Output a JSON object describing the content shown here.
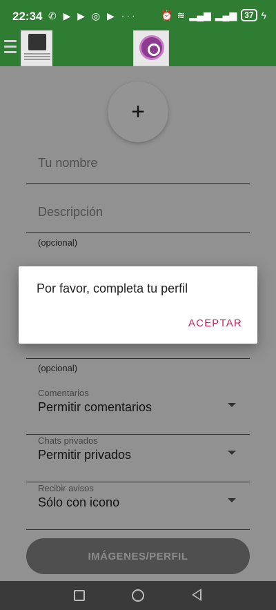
{
  "status_bar": {
    "time": "22:34",
    "left_icons": "✆ ▶ ▶ ◎ ▶ ···",
    "battery": "37",
    "icon_names": [
      "whatsapp-icon",
      "youtube-icon",
      "play-icon",
      "target-icon",
      "play-icon",
      "more-icon",
      "alarm-icon",
      "wifi-icon",
      "signal-icon",
      "signal-icon",
      "battery-icon",
      "charging-icon"
    ]
  },
  "app_bar": {
    "background": "#2e7d32"
  },
  "form": {
    "add_photo_symbol": "+",
    "name_placeholder": "Tu nombre",
    "description_placeholder": "Descripción",
    "description_helper": "(opcional)",
    "second_helper": "(opcional)",
    "comments": {
      "label": "Comentarios",
      "value": "Permitir comentarios"
    },
    "private_chats": {
      "label": "Chats privados",
      "value": "Permitir privados"
    },
    "notifications": {
      "label": "Recibir avisos",
      "value": "Sólo con icono"
    },
    "images_button": "IMÁGENES/PERFIL"
  },
  "dialog": {
    "message": "Por favor, completa tu perfil",
    "accept": "ACEPTAR",
    "accent_color": "#d81b60"
  }
}
